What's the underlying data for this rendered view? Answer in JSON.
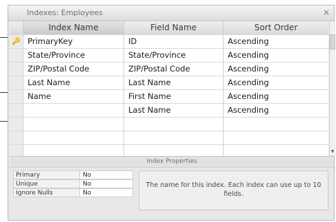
{
  "window": {
    "title": "Indexes: Employees",
    "close_label": "×"
  },
  "grid": {
    "headers": {
      "index_name": "Index Name",
      "field_name": "Field Name",
      "sort_order": "Sort Order"
    },
    "rows": [
      {
        "key": "🔑",
        "index_name": "PrimaryKey",
        "field_name": "ID",
        "sort_order": "Ascending"
      },
      {
        "key": "",
        "index_name": "State/Province",
        "field_name": "State/Province",
        "sort_order": "Ascending"
      },
      {
        "key": "",
        "index_name": "ZIP/Postal Code",
        "field_name": "ZIP/Postal Code",
        "sort_order": "Ascending"
      },
      {
        "key": "",
        "index_name": "Last Name",
        "field_name": "Last Name",
        "sort_order": "Ascending"
      },
      {
        "key": "",
        "index_name": "Name",
        "field_name": "First Name",
        "sort_order": "Ascending"
      },
      {
        "key": "",
        "index_name": "",
        "field_name": "Last Name",
        "sort_order": "Ascending"
      },
      {
        "key": "",
        "index_name": "",
        "field_name": "",
        "sort_order": ""
      },
      {
        "key": "",
        "index_name": "",
        "field_name": "",
        "sort_order": ""
      },
      {
        "key": "",
        "index_name": "",
        "field_name": "",
        "sort_order": ""
      }
    ]
  },
  "properties": {
    "section_title": "Index Properties",
    "primary": {
      "label": "Primary",
      "value": "No"
    },
    "unique": {
      "label": "Unique",
      "value": "No"
    },
    "ignore_nulls": {
      "label": "Ignore Nulls",
      "value": "No"
    },
    "description": "The name for this index.  Each index can use up to 10 fields."
  },
  "icons": {
    "primary_key": "key-icon",
    "scroll_down": "scroll-down-arrow-icon"
  },
  "colors": {
    "key_icon": "#8a7a2a",
    "selected_header": "#cacaca"
  }
}
